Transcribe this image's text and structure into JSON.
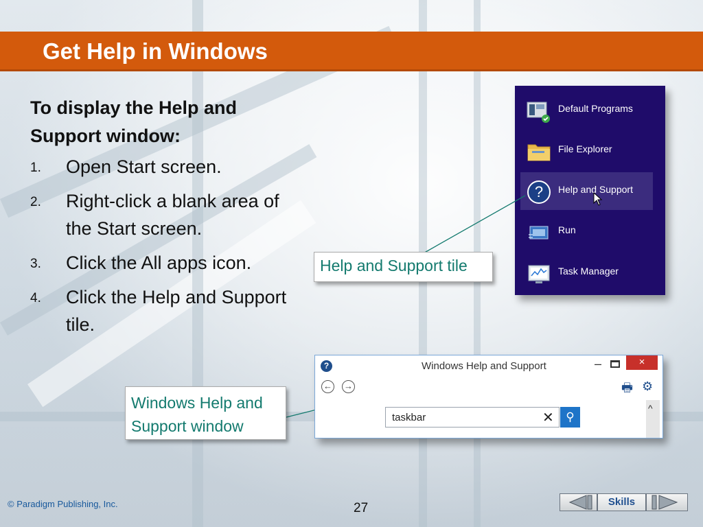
{
  "slide": {
    "title": "Get Help in Windows",
    "intro": "To display the Help and Support window:",
    "steps": [
      {
        "num": "1.",
        "text": "Open Start screen."
      },
      {
        "num": "2.",
        "text": "Right-click a blank area of the Start screen."
      },
      {
        "num": "3.",
        "text": "Click the All apps icon."
      },
      {
        "num": "4.",
        "text": "Click the Help and Support tile."
      }
    ]
  },
  "start_menu": {
    "tiles": [
      {
        "label": "Default Programs",
        "icon": "default-programs-icon"
      },
      {
        "label": "File Explorer",
        "icon": "folder-icon"
      },
      {
        "label": "Help and Support",
        "icon": "help-icon",
        "selected": true
      },
      {
        "label": "Run",
        "icon": "run-icon"
      },
      {
        "label": "Task Manager",
        "icon": "task-manager-icon"
      }
    ]
  },
  "callouts": {
    "tile": "Help and Support tile",
    "window_line1": "Windows Help and",
    "window_line2": "Support window"
  },
  "help_window": {
    "title": "Windows Help and Support",
    "help_glyph": "?",
    "back_glyph": "←",
    "forward_glyph": "→",
    "print_glyph": "🖶",
    "settings_glyph": "⚙",
    "minimize_glyph": "–",
    "close_glyph": "×",
    "search_value": "taskbar",
    "clear_glyph": "✕",
    "search_glyph": "⚲",
    "scroll_up_glyph": "^"
  },
  "footer": {
    "copyright": "© Paradigm Publishing, Inc.",
    "page": "27",
    "skills": "Skills"
  },
  "colors": {
    "title_bar": "#d35a0c",
    "callout_text": "#137a6e",
    "start_bg": "#1f0c6a"
  }
}
